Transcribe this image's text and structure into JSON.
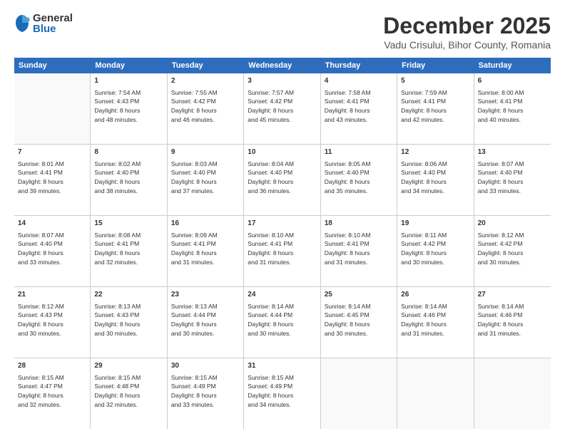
{
  "logo": {
    "general": "General",
    "blue": "Blue"
  },
  "title": "December 2025",
  "subtitle": "Vadu Crisului, Bihor County, Romania",
  "header": {
    "days": [
      "Sunday",
      "Monday",
      "Tuesday",
      "Wednesday",
      "Thursday",
      "Friday",
      "Saturday"
    ]
  },
  "weeks": [
    [
      {
        "day": "",
        "content": ""
      },
      {
        "day": "1",
        "content": "Sunrise: 7:54 AM\nSunset: 4:43 PM\nDaylight: 8 hours\nand 48 minutes."
      },
      {
        "day": "2",
        "content": "Sunrise: 7:55 AM\nSunset: 4:42 PM\nDaylight: 8 hours\nand 46 minutes."
      },
      {
        "day": "3",
        "content": "Sunrise: 7:57 AM\nSunset: 4:42 PM\nDaylight: 8 hours\nand 45 minutes."
      },
      {
        "day": "4",
        "content": "Sunrise: 7:58 AM\nSunset: 4:41 PM\nDaylight: 8 hours\nand 43 minutes."
      },
      {
        "day": "5",
        "content": "Sunrise: 7:59 AM\nSunset: 4:41 PM\nDaylight: 8 hours\nand 42 minutes."
      },
      {
        "day": "6",
        "content": "Sunrise: 8:00 AM\nSunset: 4:41 PM\nDaylight: 8 hours\nand 40 minutes."
      }
    ],
    [
      {
        "day": "7",
        "content": "Sunrise: 8:01 AM\nSunset: 4:41 PM\nDaylight: 8 hours\nand 39 minutes."
      },
      {
        "day": "8",
        "content": "Sunrise: 8:02 AM\nSunset: 4:40 PM\nDaylight: 8 hours\nand 38 minutes."
      },
      {
        "day": "9",
        "content": "Sunrise: 8:03 AM\nSunset: 4:40 PM\nDaylight: 8 hours\nand 37 minutes."
      },
      {
        "day": "10",
        "content": "Sunrise: 8:04 AM\nSunset: 4:40 PM\nDaylight: 8 hours\nand 36 minutes."
      },
      {
        "day": "11",
        "content": "Sunrise: 8:05 AM\nSunset: 4:40 PM\nDaylight: 8 hours\nand 35 minutes."
      },
      {
        "day": "12",
        "content": "Sunrise: 8:06 AM\nSunset: 4:40 PM\nDaylight: 8 hours\nand 34 minutes."
      },
      {
        "day": "13",
        "content": "Sunrise: 8:07 AM\nSunset: 4:40 PM\nDaylight: 8 hours\nand 33 minutes."
      }
    ],
    [
      {
        "day": "14",
        "content": "Sunrise: 8:07 AM\nSunset: 4:40 PM\nDaylight: 8 hours\nand 33 minutes."
      },
      {
        "day": "15",
        "content": "Sunrise: 8:08 AM\nSunset: 4:41 PM\nDaylight: 8 hours\nand 32 minutes."
      },
      {
        "day": "16",
        "content": "Sunrise: 8:09 AM\nSunset: 4:41 PM\nDaylight: 8 hours\nand 31 minutes."
      },
      {
        "day": "17",
        "content": "Sunrise: 8:10 AM\nSunset: 4:41 PM\nDaylight: 8 hours\nand 31 minutes."
      },
      {
        "day": "18",
        "content": "Sunrise: 8:10 AM\nSunset: 4:41 PM\nDaylight: 8 hours\nand 31 minutes."
      },
      {
        "day": "19",
        "content": "Sunrise: 8:11 AM\nSunset: 4:42 PM\nDaylight: 8 hours\nand 30 minutes."
      },
      {
        "day": "20",
        "content": "Sunrise: 8:12 AM\nSunset: 4:42 PM\nDaylight: 8 hours\nand 30 minutes."
      }
    ],
    [
      {
        "day": "21",
        "content": "Sunrise: 8:12 AM\nSunset: 4:43 PM\nDaylight: 8 hours\nand 30 minutes."
      },
      {
        "day": "22",
        "content": "Sunrise: 8:13 AM\nSunset: 4:43 PM\nDaylight: 8 hours\nand 30 minutes."
      },
      {
        "day": "23",
        "content": "Sunrise: 8:13 AM\nSunset: 4:44 PM\nDaylight: 8 hours\nand 30 minutes."
      },
      {
        "day": "24",
        "content": "Sunrise: 8:14 AM\nSunset: 4:44 PM\nDaylight: 8 hours\nand 30 minutes."
      },
      {
        "day": "25",
        "content": "Sunrise: 8:14 AM\nSunset: 4:45 PM\nDaylight: 8 hours\nand 30 minutes."
      },
      {
        "day": "26",
        "content": "Sunrise: 8:14 AM\nSunset: 4:46 PM\nDaylight: 8 hours\nand 31 minutes."
      },
      {
        "day": "27",
        "content": "Sunrise: 8:14 AM\nSunset: 4:46 PM\nDaylight: 8 hours\nand 31 minutes."
      }
    ],
    [
      {
        "day": "28",
        "content": "Sunrise: 8:15 AM\nSunset: 4:47 PM\nDaylight: 8 hours\nand 32 minutes."
      },
      {
        "day": "29",
        "content": "Sunrise: 8:15 AM\nSunset: 4:48 PM\nDaylight: 8 hours\nand 32 minutes."
      },
      {
        "day": "30",
        "content": "Sunrise: 8:15 AM\nSunset: 4:49 PM\nDaylight: 8 hours\nand 33 minutes."
      },
      {
        "day": "31",
        "content": "Sunrise: 8:15 AM\nSunset: 4:49 PM\nDaylight: 8 hours\nand 34 minutes."
      },
      {
        "day": "",
        "content": ""
      },
      {
        "day": "",
        "content": ""
      },
      {
        "day": "",
        "content": ""
      }
    ]
  ]
}
